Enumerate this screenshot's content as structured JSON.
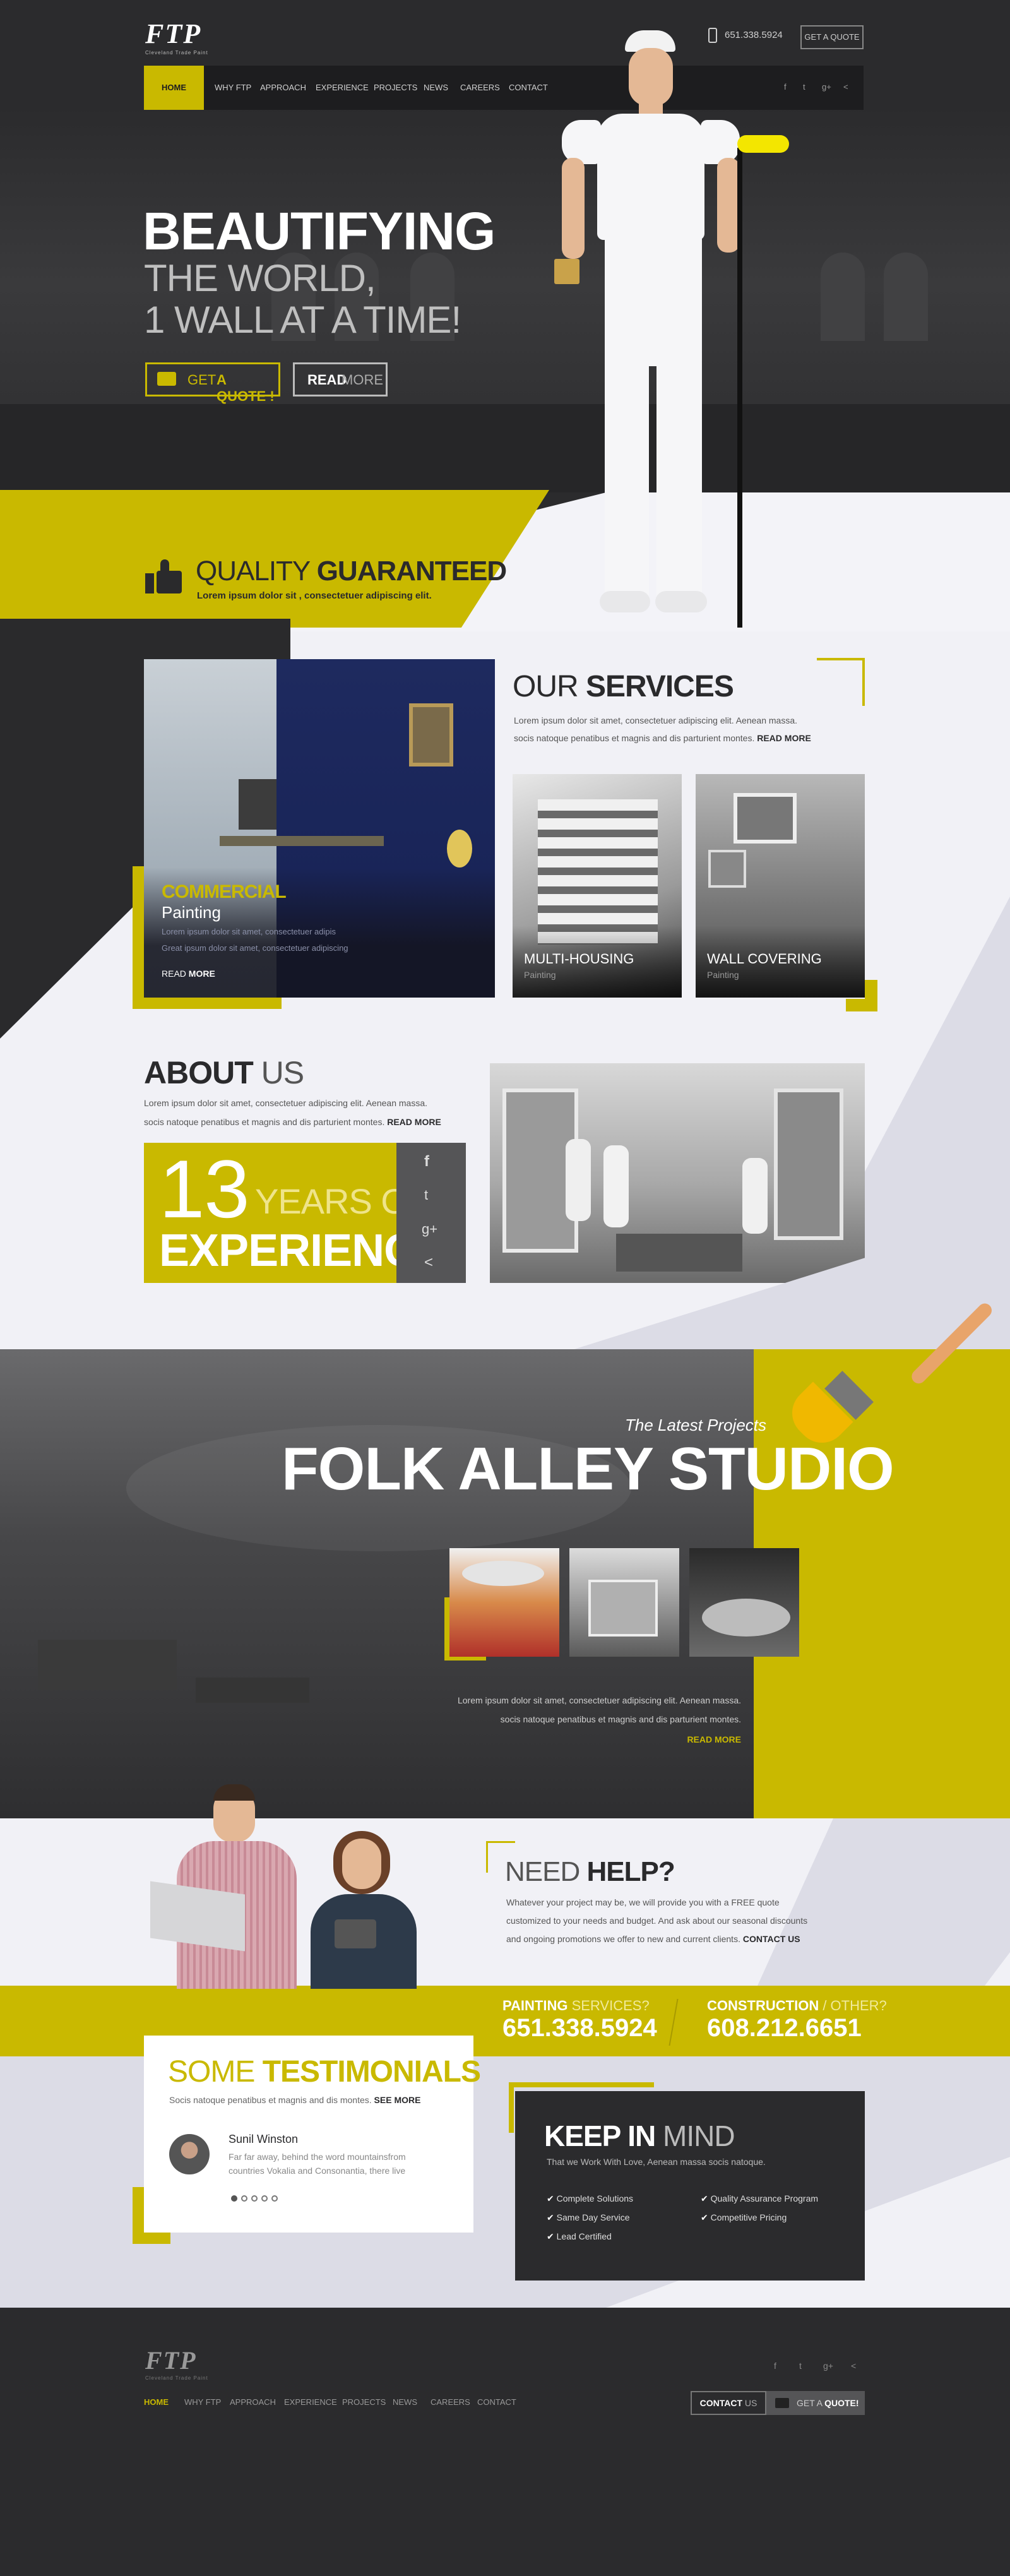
{
  "brand": {
    "logo": "FTP",
    "tagline": "Cleveland Trade Paint"
  },
  "header": {
    "phone": "651.338.5924",
    "quote_button": "GET A QUOTE"
  },
  "nav": {
    "items": [
      "HOME",
      "WHY FTP",
      "APPROACH",
      "EXPERIENCE",
      "PROJECTS",
      "NEWS",
      "CAREERS",
      "CONTACT"
    ],
    "social": [
      "f",
      "t",
      "g+",
      "share"
    ]
  },
  "hero": {
    "title": "BEAUTIFYING",
    "line2": "THE WORLD,",
    "line3": "1 WALL AT A TIME!",
    "quote_btn_a": "GET ",
    "quote_btn_b": "A QUOTE !",
    "read_btn_a": "READ",
    "read_btn_b": " MORE"
  },
  "quality": {
    "title_a": "QUALITY ",
    "title_b": "GUARANTEED",
    "subtitle": "Lorem ipsum dolor sit , consectetuer adipiscing elit."
  },
  "services": {
    "title_a": "OUR ",
    "title_b": "SERVICES",
    "text1": "Lorem ipsum dolor sit amet, consectetuer adipiscing elit. Aenean massa.",
    "text2": "socis natoque penatibus et magnis and dis parturient montes.",
    "read_more": "READ MORE",
    "main": {
      "title": "COMMERCIAL",
      "subtitle": "Painting",
      "text1": "Lorem ipsum dolor sit amet, consectetuer adipis",
      "text2": "Great ipsum dolor sit amet, consectetuer adipiscing",
      "read_a": "READ",
      "read_b": " MORE"
    },
    "cards": [
      {
        "title": "MULTI-HOUSING",
        "subtitle": "Painting"
      },
      {
        "title": "WALL COVERING",
        "subtitle": "Painting"
      }
    ]
  },
  "about": {
    "title_a": "ABOUT",
    "title_b": " US",
    "text1": "Lorem ipsum dolor sit amet, consectetuer adipiscing elit. Aenean massa.",
    "text2": "socis natoque penatibus et magnis and dis parturient montes.",
    "read_more": "READ MORE",
    "years": "13",
    "years_label": "YEARS OF",
    "experience": "EXPERIENCE",
    "social": [
      "f",
      "t",
      "g+",
      "share"
    ]
  },
  "projects": {
    "kicker": "The Latest Projects",
    "title": "FOLK ALLEY STUDIO",
    "text1": "Lorem ipsum dolor sit amet, consectetuer adipiscing elit. Aenean massa.",
    "text2": "socis natoque penatibus et magnis and dis parturient montes.",
    "read_more": "READ MORE"
  },
  "help": {
    "title_a": "NEED ",
    "title_b": "HELP?",
    "text1": "Whatever your project may be, we will provide you with a FREE quote",
    "text2": "customized to your needs and budget. And ask about our seasonal discounts",
    "text3": "and ongoing promotions we offer to new and current clients.",
    "contact": "CONTACT US"
  },
  "contact_bar": [
    {
      "label_a": "PAINTING ",
      "label_b": "SERVICES?",
      "phone": "651.338.5924"
    },
    {
      "label_a": "CONSTRUCTION ",
      "label_b": "/ OTHER?",
      "phone": "608.212.6651"
    }
  ],
  "testimonials": {
    "title_a": "SOME ",
    "title_b": "TESTIMONIALS",
    "subtitle": "Socis natoque penatibus et magnis and dis montes.",
    "see_more": "SEE MORE",
    "name": "Sunil Winston",
    "quote1": "Far far away, behind the word mountainsfrom",
    "quote2": "countries Vokalia and Consonantia, there live"
  },
  "keep_in_mind": {
    "title_a": "KEEP IN",
    "title_b": " MIND",
    "subtitle": "That we Work With Love, Aenean massa socis natoque.",
    "items": [
      "Complete Solutions",
      "Same Day Service",
      "Lead Certified",
      "Quality Assurance Program",
      "Competitive Pricing"
    ]
  },
  "footer": {
    "nav": [
      "HOME",
      "WHY FTP",
      "APPROACH",
      "EXPERIENCE",
      "PROJECTS",
      "NEWS",
      "CAREERS",
      "CONTACT"
    ],
    "contact_btn_a": "CONTACT",
    "contact_btn_b": " US",
    "quote_btn_a": "GET A ",
    "quote_btn_b": "QUOTE!",
    "social": [
      "f",
      "t",
      "g+",
      "share"
    ]
  },
  "colors": {
    "accent": "#c9b900",
    "dark": "#2b2b2d",
    "light": "#f1f1f6"
  }
}
